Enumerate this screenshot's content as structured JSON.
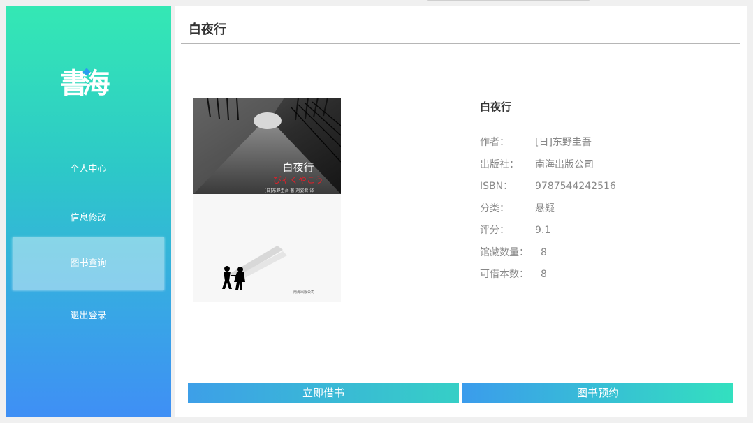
{
  "sidebar": {
    "logo": "書海",
    "logo_chars": [
      "書",
      "海"
    ],
    "nav_items": [
      {
        "label": "个人中心"
      },
      {
        "label": "信息修改"
      },
      {
        "label": "图书查询",
        "active": true
      },
      {
        "label": "退出登录"
      }
    ]
  },
  "header": {
    "title": "白夜行"
  },
  "book": {
    "cover": {
      "title": "白夜行",
      "subtitle": "びゃくやこう",
      "credit": "[日]东野圭吾 著  刘姿君 译",
      "publisher_mark": "南海出版公司"
    },
    "name": "白夜行",
    "details": [
      {
        "label": "作者：",
        "value": "[日]东野圭吾"
      },
      {
        "label": "出版社：",
        "value": "南海出版公司"
      },
      {
        "label": "ISBN：",
        "value": "9787544242516"
      },
      {
        "label": "分类：",
        "value": "悬疑"
      },
      {
        "label": "评分：",
        "value": "9.1"
      },
      {
        "label": "馆藏数量：",
        "value": "8"
      },
      {
        "label": "可借本数：",
        "value": "8"
      }
    ]
  },
  "actions": {
    "borrow_label": "立即借书",
    "reserve_label": "图书预约"
  },
  "colors": {
    "sidebar_top": "#34e8b4",
    "sidebar_bottom": "#3f8ff5",
    "button_left": "#3d9fe8",
    "button_right": "#36cfc6"
  }
}
